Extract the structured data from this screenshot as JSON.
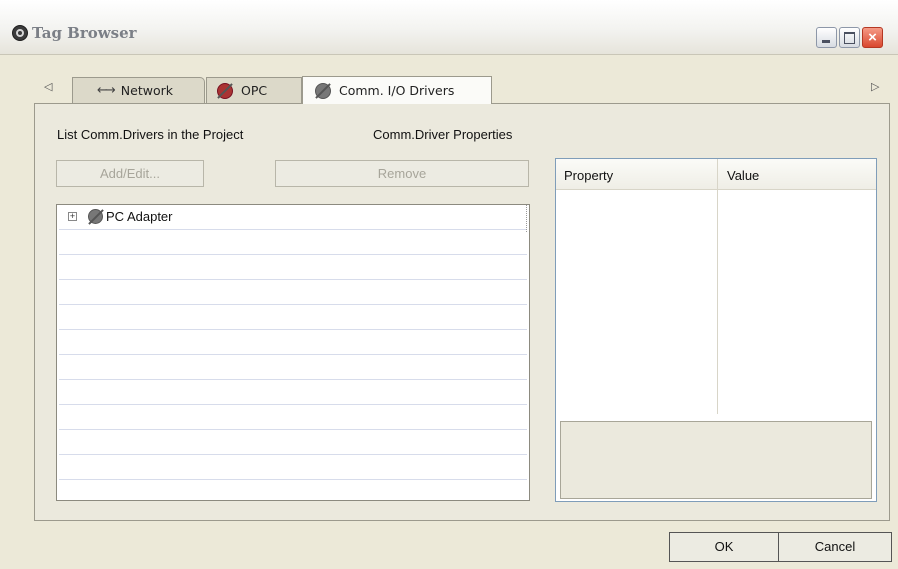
{
  "window": {
    "title": "Tag Browser"
  },
  "tabs": [
    {
      "label": "Network",
      "icon": "network-arrows-icon"
    },
    {
      "label": "OPC",
      "icon": "opc-plug-icon"
    },
    {
      "label": "Comm. I/O Drivers",
      "icon": "driver-plug-icon",
      "selected": true
    }
  ],
  "left": {
    "heading": "List Comm.Drivers in the Project",
    "add_label": "Add/Edit...",
    "remove_label": "Remove",
    "tree": [
      {
        "label": "PC Adapter",
        "icon": "driver-plug-icon",
        "expanded": false
      }
    ]
  },
  "right": {
    "heading": "Comm.Driver Properties",
    "columns": [
      "Property",
      "Value"
    ]
  },
  "footer": {
    "ok_label": "OK",
    "cancel_label": "Cancel"
  }
}
